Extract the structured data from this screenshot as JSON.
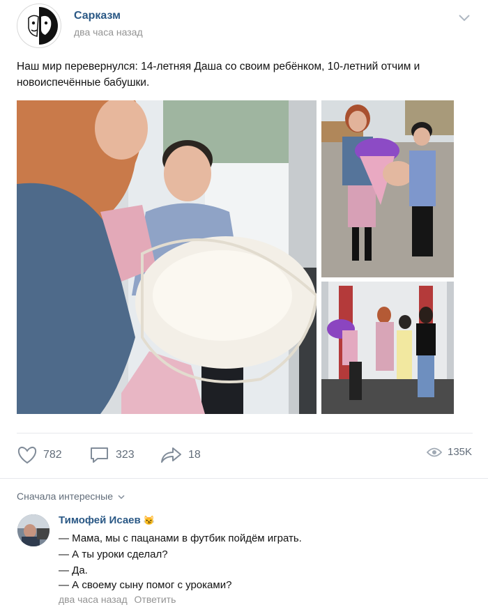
{
  "post": {
    "author": "Сарказм",
    "time": "два часа назад",
    "text": "Наш мир перевернулся: 14-летняя Даша со своим ребёнком, 10-летний отчим и новоиспечённые бабушки."
  },
  "stats": {
    "likes": "782",
    "comments": "323",
    "shares": "18",
    "views": "135K"
  },
  "comments_sort": "Сначала интересные",
  "comment": {
    "author": "Тимофей Исаев",
    "author_emoji": "😼",
    "lines": [
      "— Мама, мы с пацанами в футбик пойдём играть.",
      "— А ты уроки сделал?",
      "— Да.",
      "— А своему сыну помог с уроками?"
    ],
    "time": "два часа назад",
    "reply_label": "Ответить"
  },
  "icons": {
    "like": "heart-icon",
    "comment": "comment-icon",
    "share": "share-arrow-icon",
    "views": "eye-icon",
    "menu": "chevron-down-icon"
  },
  "colors": {
    "link": "#2a5885",
    "muted": "#939393",
    "actions": "#626d7a"
  }
}
